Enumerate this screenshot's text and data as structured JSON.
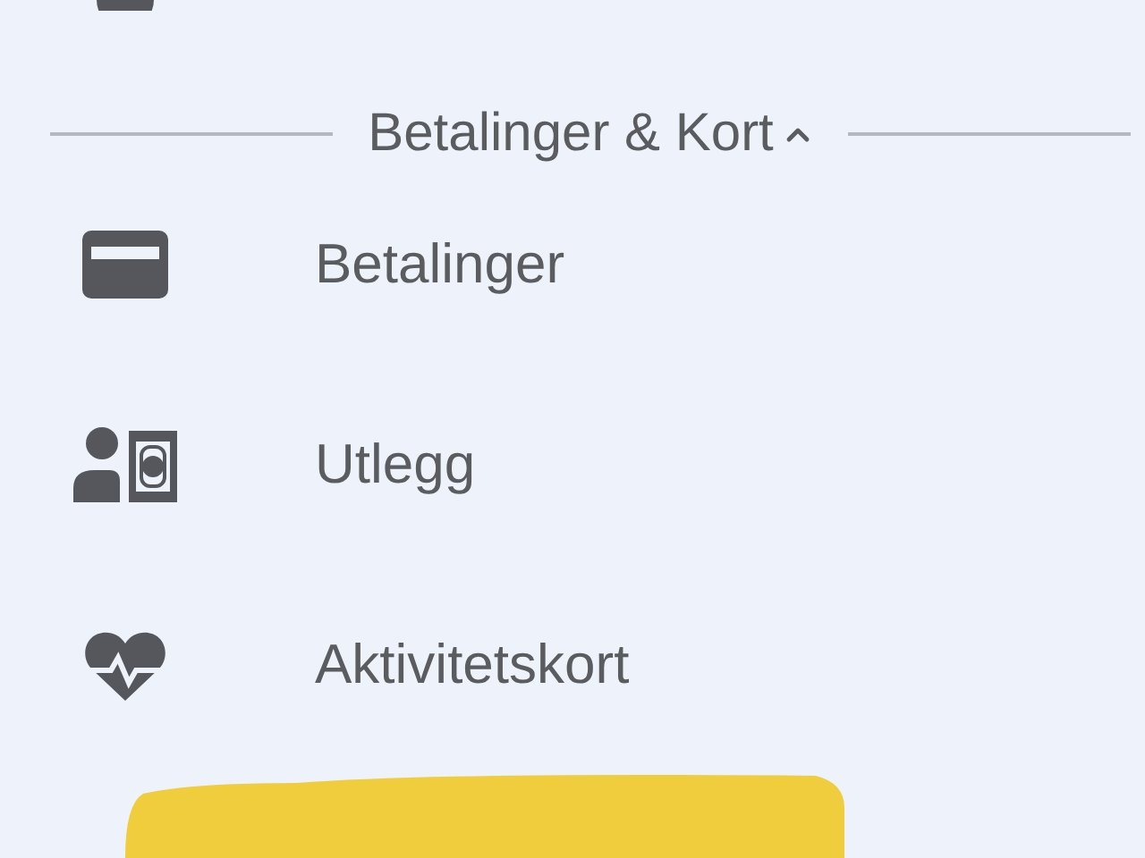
{
  "section": {
    "title": "Betalinger & Kort",
    "expanded": true,
    "items": [
      {
        "kind": "card",
        "label": "Betalinger"
      },
      {
        "kind": "expense",
        "label": "Utlegg"
      },
      {
        "kind": "activity",
        "label": "Aktivitetskort"
      }
    ]
  }
}
